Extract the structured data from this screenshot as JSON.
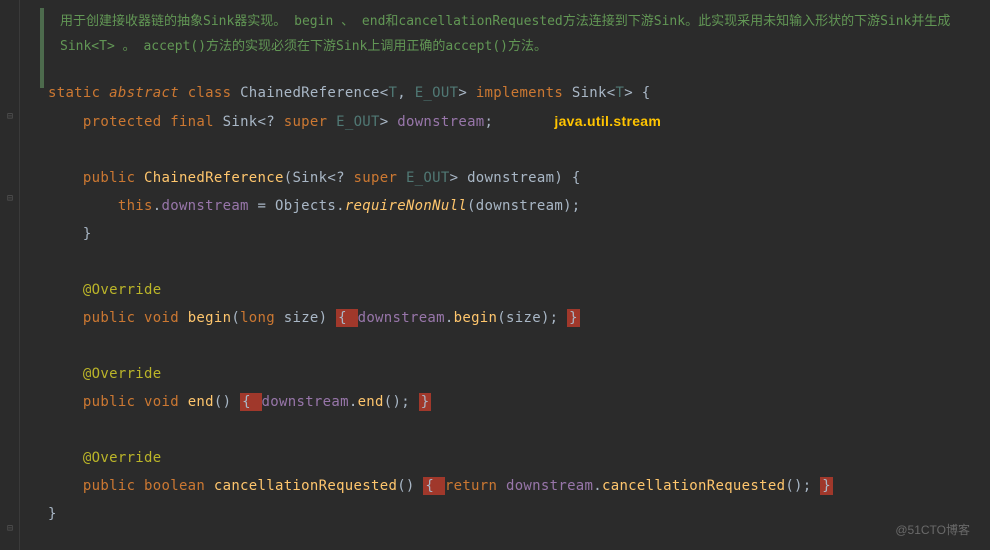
{
  "doc": {
    "text": "用于创建接收器链的抽象Sink器实现。 begin 、 end和cancellationRequested方法连接到下游Sink。此实现采用未知输入形状的下游Sink并生成Sink<T> 。 accept()方法的实现必须在下游Sink上调用正确的accept()方法。"
  },
  "annotation": {
    "package": "java.util.stream"
  },
  "code": {
    "kw_static": "static",
    "kw_abstract": "abstract",
    "kw_class": "class",
    "kw_implements": "implements",
    "kw_protected": "protected",
    "kw_final": "final",
    "kw_public": "public",
    "kw_void": "void",
    "kw_long": "long",
    "kw_boolean": "boolean",
    "kw_return": "return",
    "kw_this": "this",
    "kw_super": "super",
    "classname": "ChainedReference",
    "g_T": "T",
    "g_EOUT": "E_OUT",
    "iface": "Sink",
    "field_downstream": "downstream",
    "ctor": "ChainedReference",
    "param_downstream": "downstream",
    "objects": "Objects",
    "requireNonNull": "requireNonNull",
    "anno_override": "@Override",
    "m_begin": "begin",
    "p_size": "size",
    "m_end": "end",
    "m_cancel": "cancellationRequested"
  },
  "watermark": "@51CTO博客"
}
